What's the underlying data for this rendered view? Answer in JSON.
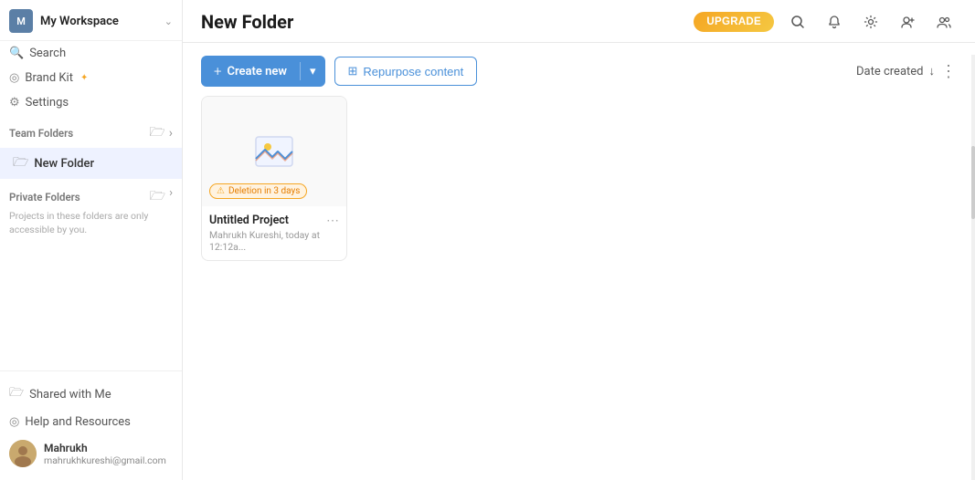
{
  "sidebar": {
    "workspace_avatar": "M",
    "workspace_name": "My Workspace",
    "search_label": "Search",
    "brand_kit_label": "Brand Kit",
    "settings_label": "Settings",
    "team_folders_label": "Team Folders",
    "active_folder": "New Folder",
    "private_folders_label": "Private Folders",
    "private_folders_note": "Projects in these folders are only accessible by you.",
    "shared_with_me_label": "Shared with Me",
    "help_label": "Help and Resources",
    "user_name": "Mahrukh",
    "user_email": "mahrukhkureshi@gmail.com"
  },
  "header": {
    "page_title": "New Folder",
    "upgrade_label": "UPGRADE"
  },
  "toolbar": {
    "create_new_label": "Create new",
    "repurpose_label": "Repurpose content",
    "sort_label": "Date created"
  },
  "project": {
    "deletion_badge": "Deletion in 3 days",
    "name": "Untitled Project",
    "meta": "Mahrukh Kureshi, today at 12:12a..."
  },
  "icons": {
    "search": "🔍",
    "chevron_down": "⌄",
    "plus": "+",
    "settings": "⚙",
    "bell": "🔔",
    "users": "👥",
    "user_add": "👤",
    "more_vert": "⋮",
    "folder": "📁",
    "new_folder": "📁",
    "repurpose": "⊞",
    "sort_desc": "↓",
    "warning": "⚠"
  }
}
